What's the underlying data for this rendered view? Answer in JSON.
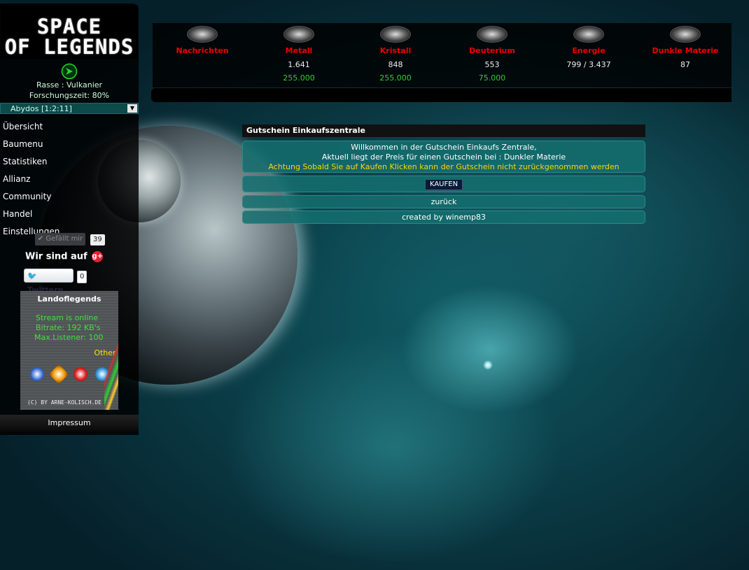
{
  "logo": {
    "line1": "SPACE",
    "line2": "OF LEGENDS"
  },
  "sidebar": {
    "race": "Rasse : Vulkanier",
    "research": "Forschungszeit: 80%",
    "planet": "Abydos [1:2:11]",
    "menu": [
      "Übersicht",
      "Baumenu",
      "Statistiken",
      "Allianz",
      "Community",
      "Handel",
      "Einstellungen"
    ],
    "like_label": "Gefällt mir",
    "like_count": "39",
    "gplus_label": "Wir sind auf",
    "tweet_label": "Twittern",
    "tweet_count": "0",
    "radio": {
      "title": "Landoflegends",
      "status": "Stream is online",
      "bitrate": "Bitrate: 192 KB's",
      "listeners": "Max.Listener: 100",
      "other": "Other Ep",
      "copyright": "(C) BY ARNE-KOLISCH.DE"
    },
    "impressum": "Impressum"
  },
  "resources": [
    {
      "name": "Nachrichten",
      "value": "",
      "production": "",
      "icon": "messages-icon"
    },
    {
      "name": "Metall",
      "value": "1.641",
      "production": "255.000",
      "icon": "metal-icon"
    },
    {
      "name": "Kristall",
      "value": "848",
      "production": "255.000",
      "icon": "crystal-icon"
    },
    {
      "name": "Deuterium",
      "value": "553",
      "production": "75.000",
      "icon": "deuterium-icon"
    },
    {
      "name": "Energie",
      "value": "799 / 3.437",
      "production": "",
      "icon": "energy-icon"
    },
    {
      "name": "Dunkle Materie",
      "value": "87",
      "production": "",
      "icon": "dark-matter-icon"
    }
  ],
  "main": {
    "title": "Gutschein Einkaufszentrale",
    "welcome": "Willkommen in der Gutschein Einkaufs Zentrale,",
    "price_text": "Aktuell liegt der Preis für einen Gutschein bei :",
    "price_value": "",
    "price_unit": "Dunkler Materie",
    "warning": "Achtung Sobald Sie auf Kaufen Klicken kann der Gutschein nicht zurückgenommen werden",
    "buy_label": "KAUFEN",
    "back_label": "zurück",
    "credit": "created by winemp83"
  },
  "colors": {
    "resource_name": "#ee0000",
    "production": "#33cc33",
    "warning": "#ffd700",
    "panel": "#146e6e"
  }
}
